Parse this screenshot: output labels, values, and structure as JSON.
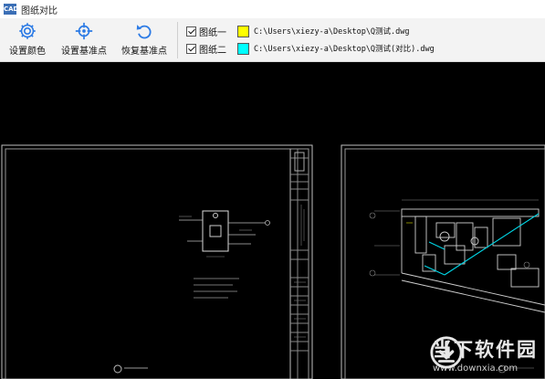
{
  "window": {
    "title": "图纸对比",
    "app_icon_text": "CAD"
  },
  "toolbar": {
    "buttons": [
      {
        "label": "设置颜色",
        "icon": "gear-icon"
      },
      {
        "label": "设置基准点",
        "icon": "crosshair-icon"
      },
      {
        "label": "恢复基准点",
        "icon": "undo-icon"
      }
    ]
  },
  "files": [
    {
      "checked": true,
      "name": "图纸一",
      "color": "#ffff00",
      "path": "C:\\Users\\xiezy-a\\Desktop\\Q测试.dwg"
    },
    {
      "checked": true,
      "name": "图纸二",
      "color": "#00ffff",
      "path": "C:\\Users\\xiezy-a\\Desktop\\Q测试(对比).dwg"
    }
  ],
  "watermark": {
    "name": "当下软件园",
    "url": "www.downxia.com"
  }
}
